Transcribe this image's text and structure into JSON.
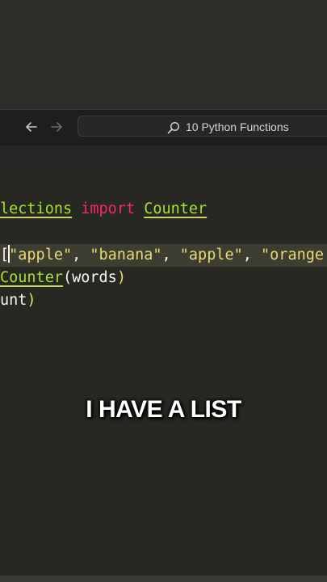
{
  "search": {
    "label": "10 Python Functions"
  },
  "code": {
    "line1": {
      "t1": "lections",
      "t2": " ",
      "t3": "import",
      "t4": " ",
      "t5": "Counter"
    },
    "line2": {
      "t1": "[",
      "t2": "\"apple\"",
      "t3": ", ",
      "t4": "\"banana\"",
      "t5": ", ",
      "t6": "\"apple\"",
      "t7": ", ",
      "t8": "\"orange"
    },
    "line3": {
      "t1": "Counter",
      "t2": "(",
      "t3": "words",
      "t4": ")"
    },
    "line4": {
      "t1": "unt",
      "t2": ")"
    }
  },
  "caption": "I HAVE A LIST",
  "colors": {
    "keyword": "#f92672",
    "string": "#e6db74",
    "class": "#a6e22e",
    "text": "#f8f8f2"
  }
}
